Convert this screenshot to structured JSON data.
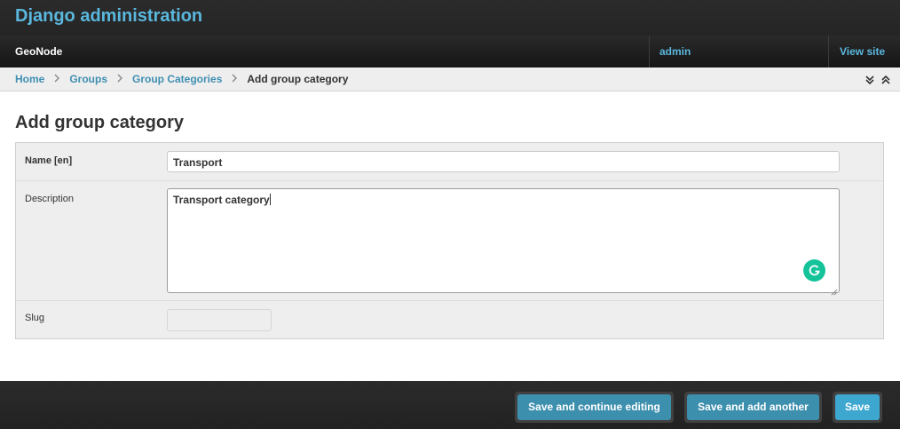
{
  "header": {
    "brand": "Django administration",
    "site_name": "GeoNode",
    "user": "admin",
    "view_site": "View site"
  },
  "breadcrumbs": {
    "items": [
      "Home",
      "Groups",
      "Group Categories"
    ],
    "current": "Add group category"
  },
  "page": {
    "title": "Add group category"
  },
  "form": {
    "name": {
      "label": "Name [en]",
      "value": "Transport"
    },
    "description": {
      "label": "Description",
      "value": "Transport category"
    },
    "slug": {
      "label": "Slug",
      "value": ""
    }
  },
  "actions": {
    "save_continue": "Save and continue editing",
    "save_add": "Save and add another",
    "save": "Save"
  },
  "colors": {
    "accent": "#5ab7dd",
    "link": "#3f8fb2",
    "button": "#3d8fae",
    "grammarly": "#15c39a"
  },
  "icons": [
    "chevron-right-icon",
    "collapse-down-icon",
    "collapse-up-icon",
    "grammarly-icon",
    "resize-handle-icon"
  ]
}
